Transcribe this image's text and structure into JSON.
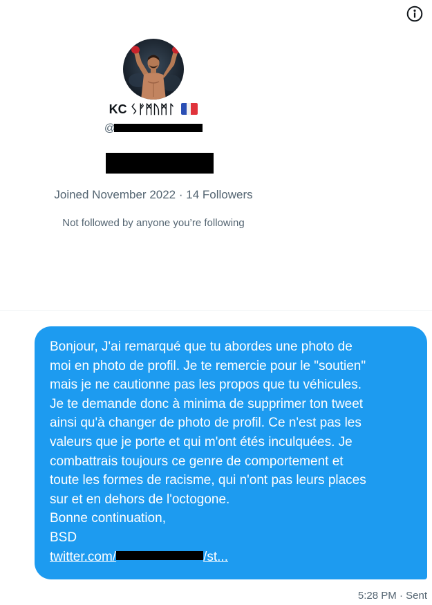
{
  "profile": {
    "display_name": "KC ᛊᚠᛗᚢᛗᛚ",
    "flag_emoji": "🇫🇷",
    "handle_prefix": "@",
    "joined": "Joined November 2022",
    "meta_separator": " · ",
    "followers": "14 Followers",
    "mutual_followers": "Not followed by anyone you’re following"
  },
  "info_button": {
    "icon": "info-circle-icon"
  },
  "message": {
    "text": "Bonjour, J'ai remarqué que tu abordes une photo de\nmoi en photo de profil. Je te remercie pour le \"soutien\"\nmais je ne cautionne pas les propos que tu véhicules.\nJe te demande donc à minima de supprimer ton tweet\nainsi qu'à changer de photo de profil. Ce n'est pas les\nvaleurs que je porte et qui m'ont étés inculquées. Je\ncombattrais toujours ce genre de comportement et\ntoute les formes de racisme, qui n'ont pas leurs places\nsur et en dehors de l'octogone.\nBonne continuation,\nBSD",
    "link_prefix": "twitter.com/",
    "link_suffix": "/st...",
    "time": "5:28 PM",
    "status_separator": " · ",
    "status": "Sent",
    "bubble_color": "#1d9bf0"
  }
}
